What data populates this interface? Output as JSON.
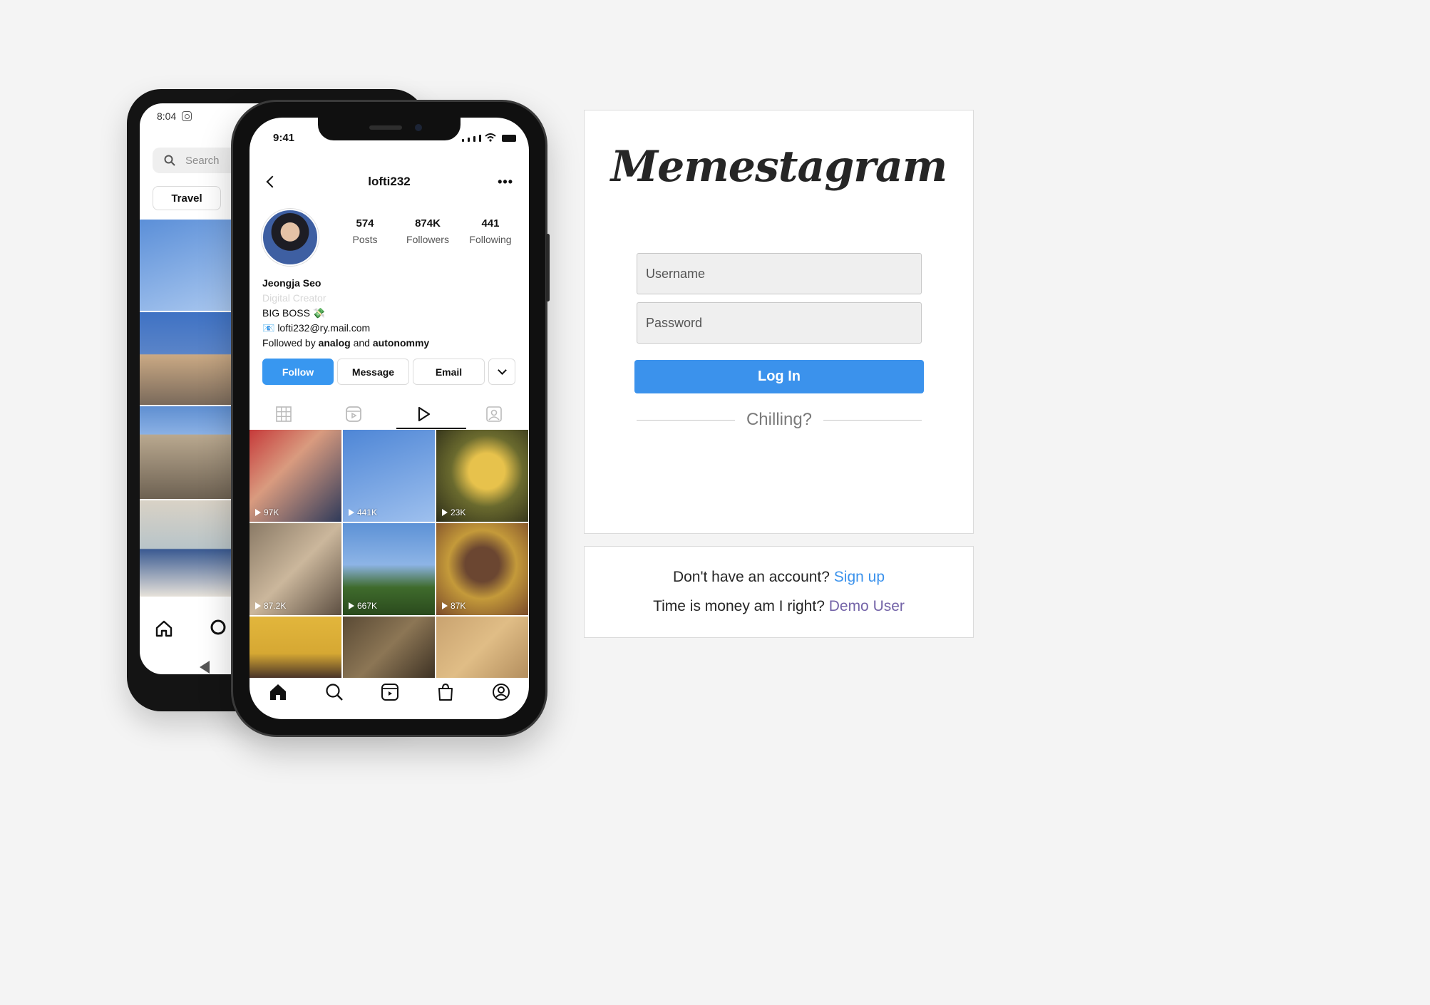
{
  "back_phone": {
    "time": "8:04",
    "search_placeholder": "Search",
    "chip_label": "Travel"
  },
  "front_phone": {
    "time": "9:41",
    "username": "lofti232",
    "more": "•••",
    "stats": [
      {
        "value": "574",
        "label": "Posts"
      },
      {
        "value": "874K",
        "label": "Followers"
      },
      {
        "value": "441",
        "label": "Following"
      }
    ],
    "bio": {
      "name": "Jeongja Seo",
      "category": "Digital Creator",
      "line1": "BIG BOSS 💸",
      "email": "📧 lofti232@ry.mail.com",
      "followed_prefix": "Followed by ",
      "followed_a": "analog",
      "followed_mid": " and ",
      "followed_b": "autonommy"
    },
    "buttons": {
      "follow": "Follow",
      "message": "Message",
      "email": "Email"
    },
    "grid_counts": [
      "97K",
      "441K",
      "23K",
      "87.2K",
      "667K",
      "87K"
    ]
  },
  "login": {
    "logo": "Memestagram",
    "username_placeholder": "Username",
    "password_placeholder": "Password",
    "login_button": "Log In",
    "divider_text": "Chilling?"
  },
  "signup": {
    "prompt": "Don't have an account? ",
    "signup_link": "Sign up",
    "demo_prompt": "Time is money am I right? ",
    "demo_link": "Demo User"
  },
  "colors": {
    "accent": "#3b92ec",
    "demo_link": "#7464a8",
    "background": "#f4f4f4"
  }
}
